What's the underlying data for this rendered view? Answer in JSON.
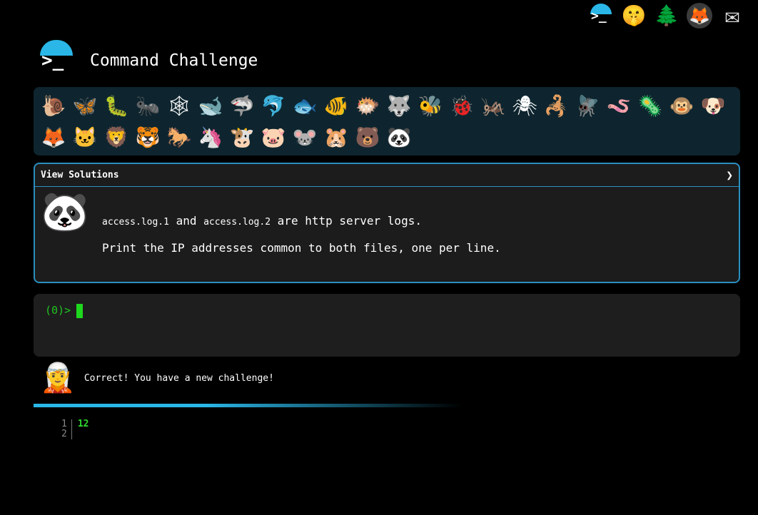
{
  "top_icons": [
    {
      "name": "terminal-logo-icon",
      "glyph": "",
      "label": ">_"
    },
    {
      "name": "shushing-face-icon",
      "glyph": "🤫"
    },
    {
      "name": "tree-icon",
      "glyph": "🌲"
    },
    {
      "name": "gitlab-icon",
      "glyph": "🦊"
    },
    {
      "name": "mail-icon",
      "glyph": "✉"
    }
  ],
  "logo": {
    "prompt": ">_"
  },
  "app_title": "Command Challenge",
  "animals": [
    {
      "name": "snail-icon",
      "glyph": "🐌"
    },
    {
      "name": "butterfly-icon",
      "glyph": "🦋"
    },
    {
      "name": "caterpillar-icon",
      "glyph": "🐛"
    },
    {
      "name": "ant-icon",
      "glyph": "🐜"
    },
    {
      "name": "spider-web-icon",
      "glyph": "🕸"
    },
    {
      "name": "whale-icon",
      "glyph": "🐋"
    },
    {
      "name": "shark-icon",
      "glyph": "🦈"
    },
    {
      "name": "dolphin-icon",
      "glyph": "🐬"
    },
    {
      "name": "fish-icon",
      "glyph": "🐟"
    },
    {
      "name": "tropical-fish-icon",
      "glyph": "🐠"
    },
    {
      "name": "blowfish-icon",
      "glyph": "🐡"
    },
    {
      "name": "wolf-icon",
      "glyph": "🐺"
    },
    {
      "name": "bee-icon",
      "glyph": "🐝"
    },
    {
      "name": "ladybug-icon",
      "glyph": "🐞"
    },
    {
      "name": "cricket-icon",
      "glyph": "🦗"
    },
    {
      "name": "spider-icon",
      "glyph": "🕷"
    },
    {
      "name": "scorpion-icon",
      "glyph": "🦂"
    },
    {
      "name": "fly-icon",
      "glyph": "🪰"
    },
    {
      "name": "worm-icon",
      "glyph": "🪱"
    },
    {
      "name": "microbe-icon",
      "glyph": "🦠"
    },
    {
      "name": "monkey-icon",
      "glyph": "🐵"
    },
    {
      "name": "dog-icon",
      "glyph": "🐶"
    },
    {
      "name": "fox-icon",
      "glyph": "🦊"
    },
    {
      "name": "cat-icon",
      "glyph": "🐱"
    },
    {
      "name": "lion-icon",
      "glyph": "🦁"
    },
    {
      "name": "tiger-icon",
      "glyph": "🐯"
    },
    {
      "name": "horse-icon",
      "glyph": "🐎"
    },
    {
      "name": "unicorn-icon",
      "glyph": "🦄"
    },
    {
      "name": "cow-icon",
      "glyph": "🐮"
    },
    {
      "name": "pig-icon",
      "glyph": "🐷"
    },
    {
      "name": "mouse-icon",
      "glyph": "🐭"
    },
    {
      "name": "hamster-icon",
      "glyph": "🐹"
    },
    {
      "name": "bear-icon",
      "glyph": "🐻"
    },
    {
      "name": "panda-icon",
      "glyph": "🐼"
    }
  ],
  "solutions": {
    "header": "View Solutions",
    "chevron": "❯",
    "avatar_glyph": "🐼",
    "line1": {
      "code_a": "access.log.1",
      "and": "and",
      "code_b": "access.log.2",
      "rest": "are http server logs."
    },
    "line2": "Print the IP addresses common to both files, one per line."
  },
  "terminal": {
    "prompt": "(0)>"
  },
  "message": {
    "avatar_glyph": "🧝",
    "text": "Correct! You have a new challenge!"
  },
  "output": {
    "line_numbers": [
      "1",
      "2"
    ],
    "lines": [
      "12",
      ""
    ]
  },
  "colors": {
    "accent": "#2ab7e8",
    "prompt_green": "#1fc51f",
    "panel_bg": "#0e252f"
  }
}
